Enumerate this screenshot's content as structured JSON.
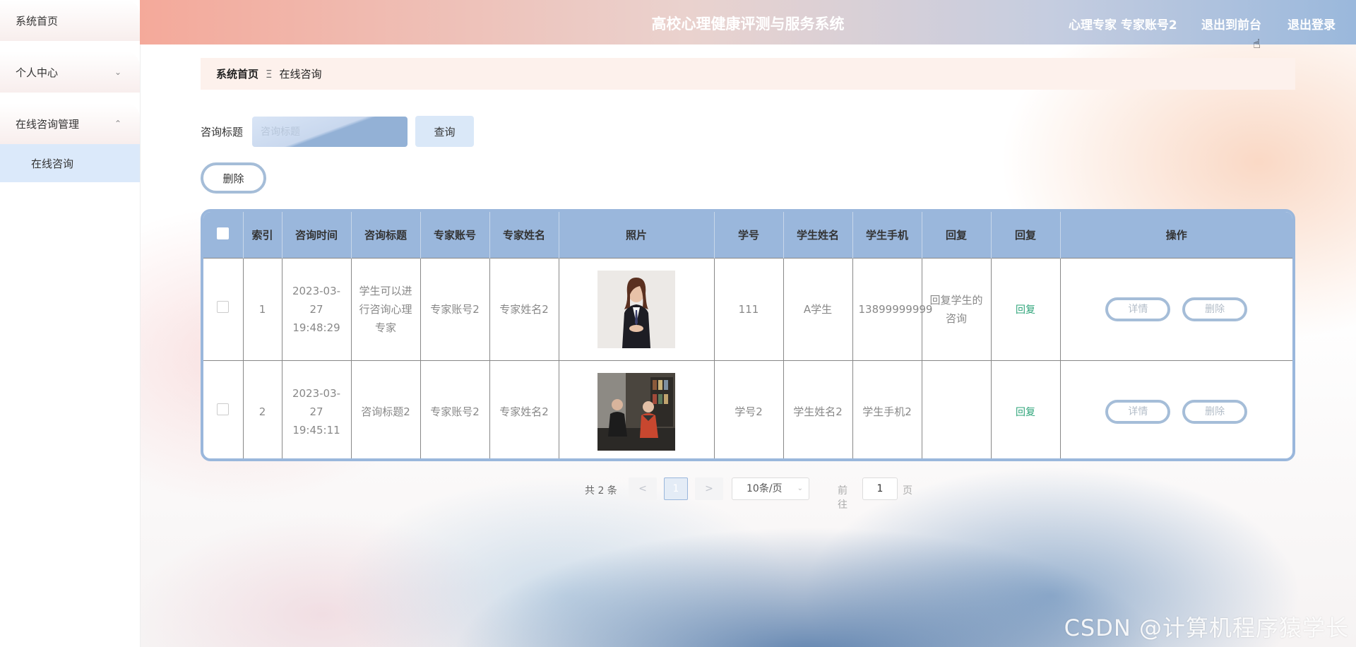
{
  "sidebar": {
    "items": [
      {
        "label": "系统首页",
        "chevron": ""
      },
      {
        "label": "个人中心",
        "chevron": "⌄"
      },
      {
        "label": "在线咨询管理",
        "chevron": "⌃"
      }
    ],
    "subitems": [
      {
        "label": "在线咨询"
      }
    ]
  },
  "header": {
    "title": "高校心理健康评测与服务系统",
    "user": "心理专家 专家账号2",
    "front_link": "退出到前台",
    "logout_link": "退出登录"
  },
  "breadcrumb": {
    "home": "系统首页",
    "separator": "Ξ",
    "current": "在线咨询"
  },
  "search": {
    "label": "咨询标题",
    "placeholder": "咨询标题",
    "button": "查询"
  },
  "actions": {
    "delete": "删除"
  },
  "table": {
    "columns": [
      "",
      "索引",
      "咨询时间",
      "咨询标题",
      "专家账号",
      "专家姓名",
      "照片",
      "学号",
      "学生姓名",
      "学生手机",
      "回复",
      "回复",
      "操作"
    ],
    "rows": [
      {
        "index": "1",
        "time": "2023-03-27 19:48:29",
        "title": "学生可以进行咨询心理专家",
        "expert_account": "专家账号2",
        "expert_name": "专家姓名2",
        "photo": "woman-in-suit-photo",
        "student_id": "111",
        "student_name": "A学生",
        "student_phone": "13899999999",
        "reply": "回复学生的咨询",
        "reply_action": "回复",
        "detail_btn": "详情",
        "delete_btn": "删除"
      },
      {
        "index": "2",
        "time": "2023-03-27 19:45:11",
        "title": "咨询标题2",
        "expert_account": "专家账号2",
        "expert_name": "专家姓名2",
        "photo": "counseling-session-photo",
        "student_id": "学号2",
        "student_name": "学生姓名2",
        "student_phone": "学生手机2",
        "reply": "",
        "reply_action": "回复",
        "detail_btn": "详情",
        "delete_btn": "删除"
      }
    ]
  },
  "pagination": {
    "total": "共 2 条",
    "prev": "<",
    "current_page": "1",
    "next": ">",
    "page_size": "10条/页",
    "goto_label": "前往",
    "jump_value": "1",
    "page_suffix": "页"
  },
  "watermark": "CSDN @计算机程序猿学长",
  "colors": {
    "header_start": "#f4a99a",
    "header_end": "#9ab8dc",
    "table_header": "#9ab7dc",
    "accent": "#2fa57a"
  }
}
